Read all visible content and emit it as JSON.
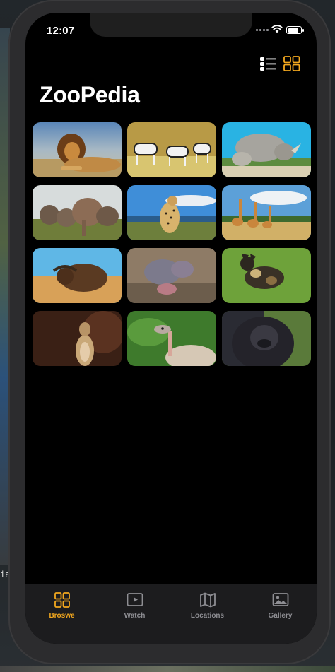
{
  "status_bar": {
    "time": "12:07",
    "battery_level": 0.9
  },
  "app": {
    "title": "ZooPedia"
  },
  "view_toggle": {
    "options": [
      "list-view",
      "grid-view"
    ],
    "selected": "grid-view"
  },
  "colors": {
    "accent": "#F3A81F",
    "inactive": "#8E8E93",
    "background": "#000000",
    "tabbar": "#1C1C1E"
  },
  "animals": [
    {
      "name": "lion"
    },
    {
      "name": "zebra"
    },
    {
      "name": "rhino"
    },
    {
      "name": "elephant"
    },
    {
      "name": "cheetah"
    },
    {
      "name": "giraffe"
    },
    {
      "name": "buffalo"
    },
    {
      "name": "hippo"
    },
    {
      "name": "wild-dog"
    },
    {
      "name": "meerkat"
    },
    {
      "name": "ostrich"
    },
    {
      "name": "gorilla"
    }
  ],
  "tabs": [
    {
      "label": "Broswe",
      "icon": "grid-icon",
      "active": true
    },
    {
      "label": "Watch",
      "icon": "play-icon",
      "active": false
    },
    {
      "label": "Locations",
      "icon": "map-icon",
      "active": false
    },
    {
      "label": "Gallery",
      "icon": "photo-icon",
      "active": false
    }
  ]
}
